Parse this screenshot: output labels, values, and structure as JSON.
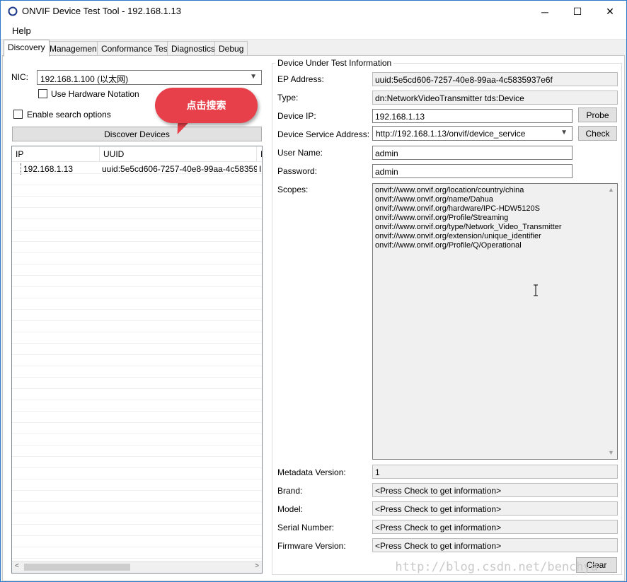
{
  "window": {
    "title": "ONVIF Device Test Tool - 192.168.1.13",
    "minimize_glyph": "─",
    "maximize_glyph": "☐",
    "close_glyph": "✕"
  },
  "menu": {
    "items": [
      "Help"
    ]
  },
  "tabs": [
    "Discovery",
    "Management",
    "Conformance Test",
    "Diagnostics",
    "Debug"
  ],
  "active_tab": "Discovery",
  "discovery": {
    "nic_label": "NIC:",
    "nic_value": "192.168.1.100 (以太网)",
    "use_hw_notation_label": "Use Hardware Notation",
    "enable_search_label": "Enable search options",
    "discover_button": "Discover Devices",
    "callout_text": "点击搜索",
    "list_headers": [
      "IP",
      "UUID",
      "I"
    ],
    "devices": [
      {
        "ip": "192.168.1.13",
        "uuid": "uuid:5e5cd606-7257-40e8-99aa-4c58359...",
        "extra": "I"
      }
    ]
  },
  "dut": {
    "group_title": "Device Under Test Information",
    "ep_address_label": "EP Address:",
    "ep_address_value": "uuid:5e5cd606-7257-40e8-99aa-4c5835937e6f",
    "type_label": "Type:",
    "type_value": "dn:NetworkVideoTransmitter tds:Device",
    "device_ip_label": "Device IP:",
    "device_ip_value": "192.168.1.13",
    "probe_button": "Probe",
    "service_address_label": "Device Service Address:",
    "service_address_value": "http://192.168.1.13/onvif/device_service",
    "check_button": "Check",
    "username_label": "User Name:",
    "username_value": "admin",
    "password_label": "Password:",
    "password_value": "admin",
    "scopes_label": "Scopes:",
    "scopes": [
      "onvif://www.onvif.org/location/country/china",
      "onvif://www.onvif.org/name/Dahua",
      "onvif://www.onvif.org/hardware/IPC-HDW5120S",
      "onvif://www.onvif.org/Profile/Streaming",
      "onvif://www.onvif.org/type/Network_Video_Transmitter",
      "onvif://www.onvif.org/extension/unique_identifier",
      "onvif://www.onvif.org/Profile/Q/Operational"
    ],
    "metadata_version_label": "Metadata Version:",
    "metadata_version_value": "1",
    "brand_label": "Brand:",
    "brand_value": "<Press Check to get information>",
    "model_label": "Model:",
    "model_value": "<Press Check to get information>",
    "serial_label": "Serial Number:",
    "serial_value": "<Press Check to get information>",
    "firmware_label": "Firmware Version:",
    "firmware_value": "<Press Check to get information>",
    "clear_button": "Clear"
  },
  "watermark": "http://blog.csdn.net/benchya"
}
